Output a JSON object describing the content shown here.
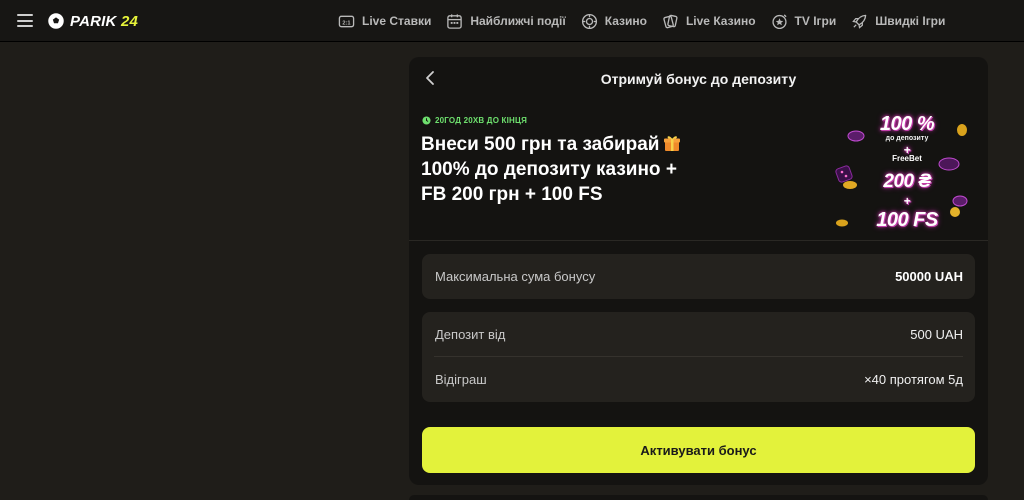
{
  "header": {
    "logo_word": "PARIK",
    "logo_num": "24",
    "nav": [
      {
        "label": "Live Ставки",
        "icon": "live-bets-icon"
      },
      {
        "label": "Найближчі події",
        "icon": "calendar-icon"
      },
      {
        "label": "Казино",
        "icon": "casino-chip-icon"
      },
      {
        "label": "Live Казино",
        "icon": "cards-icon"
      },
      {
        "label": "TV Ігри",
        "icon": "tv-games-icon"
      },
      {
        "label": "Швидкі Ігри",
        "icon": "rocket-icon"
      }
    ]
  },
  "bonus": {
    "title": "Отримуй бонус до депозиту",
    "timer": "20ГОД 20ХВ ДО КІНЦЯ",
    "headline_line1": "Внеси 500 грн та забирай",
    "headline_line2": "100% до депозиту казино +",
    "headline_line3": "FB 200 грн + 100 FS",
    "promo": {
      "percent": "100 %",
      "deposit": "до депозиту",
      "plus": "+",
      "freebet": "FreeBet",
      "fb_amount": "200 ₴",
      "fs": "100 FS"
    },
    "max_label": "Максимальна сума бонусу",
    "max_value": "50000 UAH",
    "deposit_label": "Депозит від",
    "deposit_value": "500 UAH",
    "wager_label": "Відіграш",
    "wager_value": "×40 протягом 5д",
    "cta": "Активувати бонус"
  },
  "colors": {
    "accent": "#e3f23b",
    "background": "#1f1d19",
    "card": "#141311",
    "timer": "#6ee06e"
  }
}
